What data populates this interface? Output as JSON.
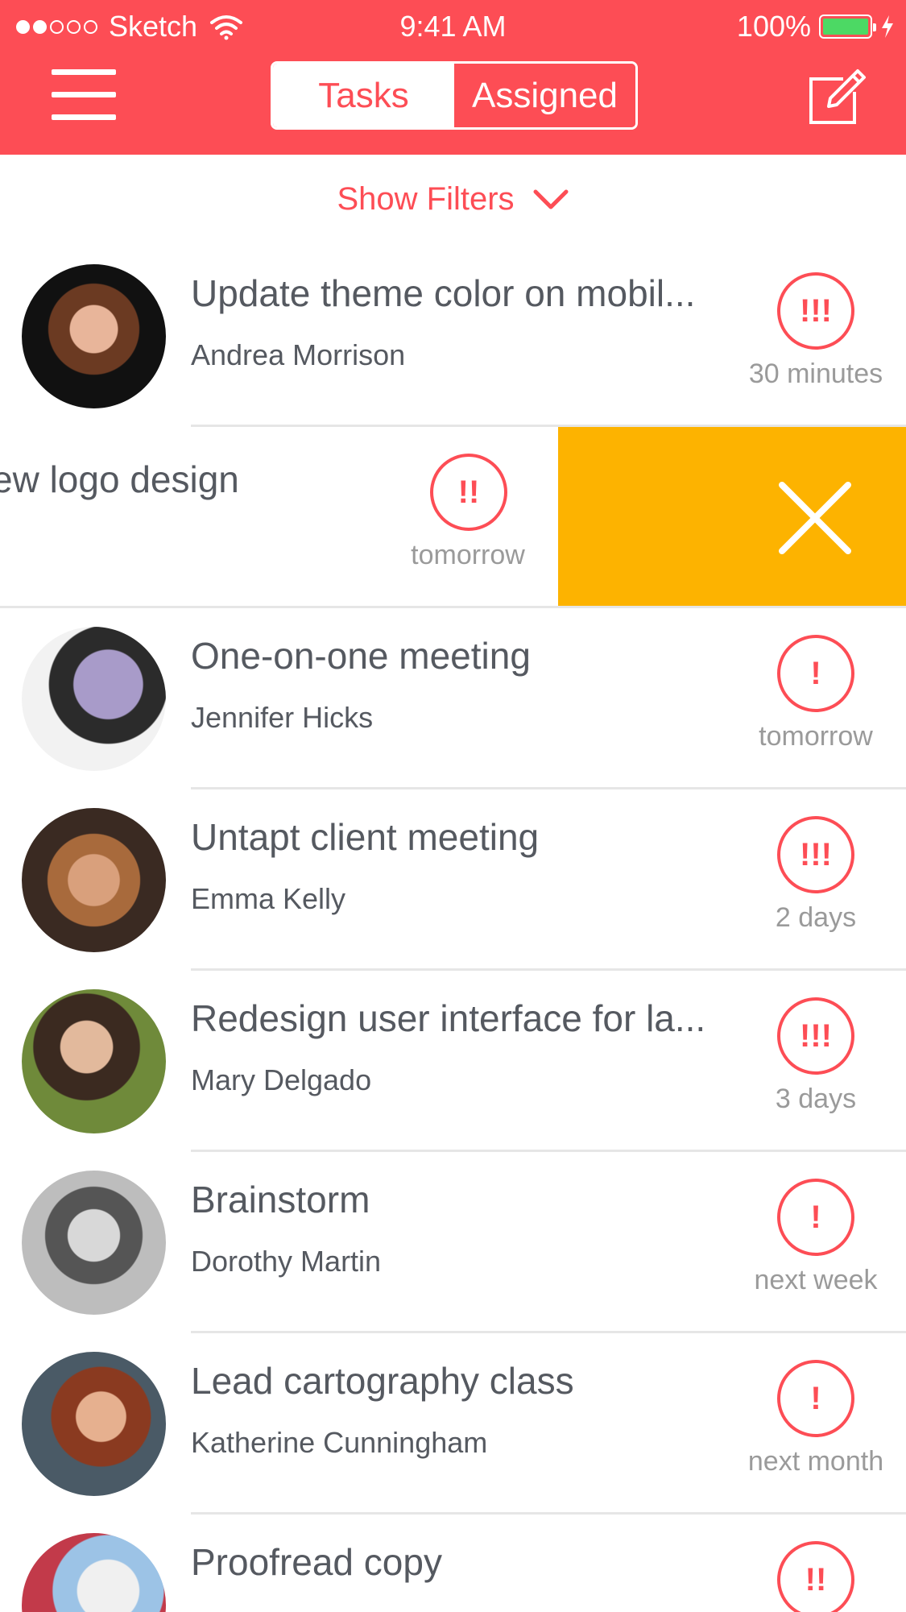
{
  "status_bar": {
    "carrier": "Sketch",
    "time": "9:41 AM",
    "battery": "100%",
    "signal_bars_filled": 2,
    "signal_bars_total": 5
  },
  "nav": {
    "menu_icon": "hamburger-menu-icon",
    "tabs": [
      {
        "label": "Tasks",
        "active": true
      },
      {
        "label": "Assigned",
        "active": false
      }
    ],
    "compose_icon": "compose-edit-icon"
  },
  "filters": {
    "label": "Show Filters",
    "icon": "chevron-down-icon"
  },
  "colors": {
    "brand": "#fd4d55",
    "delete": "#fdb300",
    "text": "#555960",
    "muted": "#9a9a9a"
  },
  "tasks": [
    {
      "title": "Update theme color on mobil...",
      "person": "Andrea Morrison",
      "priority": "!!!",
      "due": "30 minutes"
    },
    {
      "title": "ew logo design",
      "person": "",
      "priority": "!!",
      "due": "tomorrow",
      "swiped": true,
      "action_icon": "close-icon"
    },
    {
      "title": "One-on-one meeting",
      "person": "Jennifer Hicks",
      "priority": "!",
      "due": "tomorrow"
    },
    {
      "title": "Untapt client meeting",
      "person": "Emma Kelly",
      "priority": "!!!",
      "due": "2 days"
    },
    {
      "title": "Redesign user interface for la...",
      "person": "Mary Delgado",
      "priority": "!!!",
      "due": "3 days"
    },
    {
      "title": "Brainstorm",
      "person": "Dorothy Martin",
      "priority": "!",
      "due": "next week"
    },
    {
      "title": "Lead cartography class",
      "person": "Katherine Cunningham",
      "priority": "!",
      "due": "next month"
    },
    {
      "title": "Proofread copy",
      "person": "",
      "priority": "!!",
      "due": ""
    }
  ]
}
